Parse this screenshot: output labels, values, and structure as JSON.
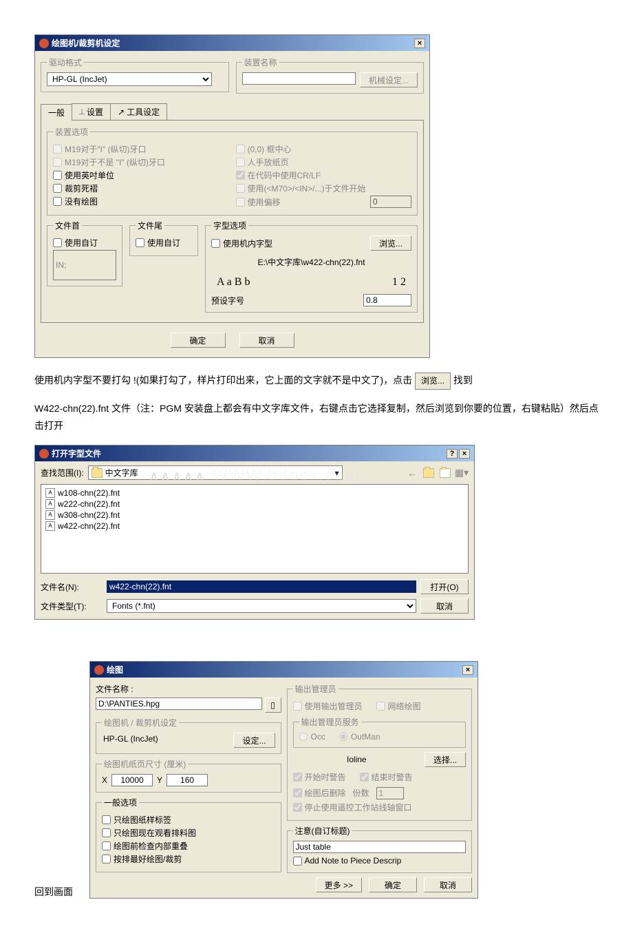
{
  "dialog1": {
    "title": "绘图机/裁剪机设定",
    "drive_format_legend": "驱动格式",
    "drive_format_value": "HP-GL (IncJet)",
    "device_name_legend": "装置名称",
    "machine_setting_btn": "机械设定...",
    "tabs": {
      "general": "一般",
      "settings": "设置",
      "tools": "工具设定"
    },
    "device_options_legend": "装置选项",
    "opt_m19_i": "M19对于\"I\" (纵切)牙口",
    "opt_m19_not_i": "M19对于不是 \"I\" (纵切)牙口",
    "opt_english_unit": "使用英吋单位",
    "opt_cut_reserve": "裁剪死褶",
    "opt_no_plot": "没有绘图",
    "opt_00_center": "(0,0) 框中心",
    "opt_manual_paper": "人手放纸页",
    "opt_crlf": "在代码中使用CR/LF",
    "opt_m70": "使用(<M70>/<IN>/...)于文件开始",
    "opt_offset": "使用偏移",
    "offset_value": "0",
    "file_head_legend": "文件首",
    "file_tail_legend": "文件尾",
    "use_custom": "使用自订",
    "in_label": "IN;",
    "font_options_legend": "字型选项",
    "use_machine_font": "使用机内字型",
    "browse_btn": "浏览...",
    "font_path": "E:\\中文字库\\w422-chn(22).fnt",
    "font_preview": "A  a  B  b",
    "font_preview2": "1  2",
    "default_font_label": "预设字号",
    "default_font_value": "0.8",
    "ok_btn": "确定",
    "cancel_btn": "取消"
  },
  "para1": {
    "text1": "使用机内字型不要打勾 !(如果打勾了，样片打印出来，它上面的文字就不是中文了)，点击",
    "browse_inline": "浏览...",
    "text2": "找到",
    "text3": "W422-chn(22).fnt 文件（注：PGM 安装盘上都会有中文字库文件，右键点击它选择复制，然后浏览到你要的位置，右键粘贴）然后点击打开"
  },
  "dialog2": {
    "title": "打开字型文件",
    "lookin_label": "查找范围(I):",
    "lookin_value": "中文字库",
    "files": [
      "w108-chn(22).fnt",
      "w222-chn(22).fnt",
      "w308-chn(22).fnt",
      "w422-chn(22).fnt"
    ],
    "filename_label": "文件名(N):",
    "filename_value": "w422-chn(22).fnt",
    "filetype_label": "文件类型(T):",
    "filetype_value": "Fonts (*.fnt)",
    "open_btn": "打开(O)",
    "cancel_btn": "取消",
    "watermark": "WWW.bdocx.com"
  },
  "dialog3": {
    "title": "绘图",
    "filename_label": "文件名称 :",
    "filename_value": "D:\\PANTIES.hpg",
    "plotter_legend": "绘图机 / 裁剪机设定",
    "plotter_value": "HP-GL (IncJet)",
    "setting_btn": "设定...",
    "paper_legend": "绘图机纸页尺寸 (厘米)",
    "x_label": "X",
    "x_value": "10000",
    "y_label": "Y",
    "y_value": "160",
    "general_legend": "一般选项",
    "opt_only_label": "只绘图纸样标签",
    "opt_only_view": "只绘图现在观看排料图",
    "opt_check_overlap": "绘图前检查内部重叠",
    "opt_best_plot": "按排最好绘图/裁剪",
    "output_mgr_legend": "输出管理员",
    "use_output_mgr": "使用输出管理员",
    "network_plot": "网络绘图",
    "output_svc_legend": "输出管理员服务",
    "occ": "Occ",
    "outman": "OutMan",
    "ioline": "Ioline",
    "select_btn": "选择...",
    "start_warn": "开始时警告",
    "end_warn": "结束时警告",
    "delete_after": "绘图后删除",
    "copies_label": "份数",
    "copies_value": "1",
    "stop_remote": "停止使用遥控工作站线轴窗口",
    "note_legend": "注意(自订标题)",
    "note_value": "Just table",
    "add_note": "Add Note to Piece Descrip",
    "more_btn": "更多 >>",
    "ok_btn": "确定",
    "cancel_btn": "取消"
  },
  "footer": "回到画面"
}
